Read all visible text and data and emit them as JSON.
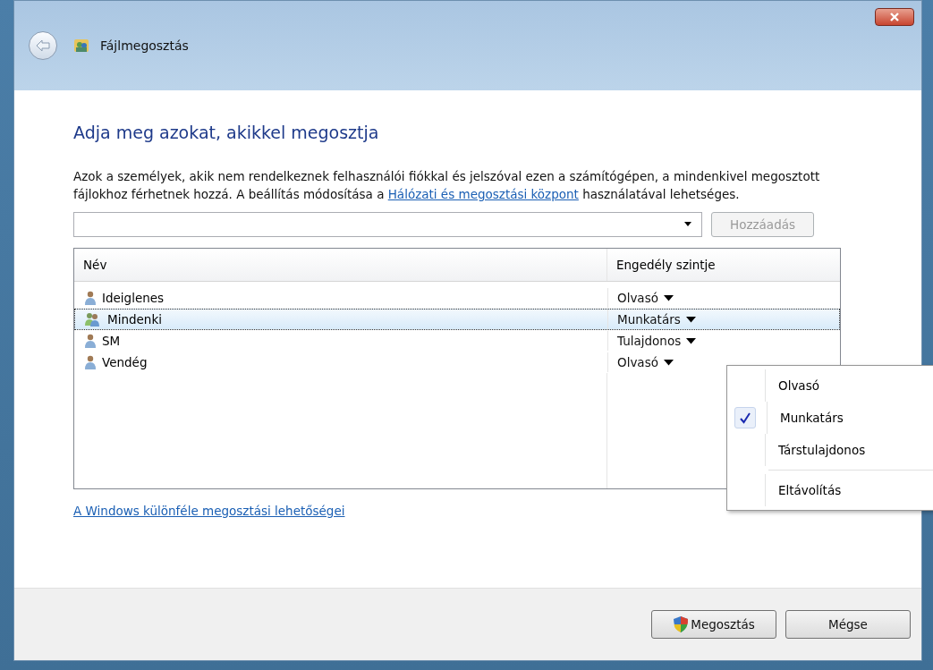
{
  "window": {
    "title": "Fájlmegosztás"
  },
  "heading": "Adja meg azokat, akikkel megosztja",
  "description": {
    "before": "Azok a személyek, akik nem rendelkeznek felhasználói fiókkal és jelszóval ezen a számítógépen, a mindenkivel megosztott fájlokhoz férhetnek hozzá. A beállítás módosítása a ",
    "link": "Hálózati és megosztási központ",
    "after": " használatával lehetséges."
  },
  "add_button": {
    "label": "Hozzáadás",
    "disabled": true
  },
  "table": {
    "columns": [
      "Név",
      "Engedély szintje"
    ],
    "rows": [
      {
        "name": "Ideiglenes",
        "kind": "user",
        "permission": "Olvasó",
        "selected": false
      },
      {
        "name": "Mindenki",
        "kind": "group",
        "permission": "Munkatárs",
        "selected": true
      },
      {
        "name": "SM",
        "kind": "user",
        "permission": "Tulajdonos",
        "selected": false
      },
      {
        "name": "Vendég",
        "kind": "user",
        "permission": "Olvasó",
        "selected": false
      }
    ]
  },
  "menu": [
    {
      "label": "Olvasó",
      "kind": "option",
      "checked": false
    },
    {
      "label": "Munkatárs",
      "kind": "option",
      "checked": true
    },
    {
      "label": "Társtulajdonos",
      "kind": "option",
      "checked": false
    },
    {
      "label": "Eltávolítás",
      "kind": "action",
      "checked": false
    }
  ],
  "options_link": "A Windows különféle megosztási lehetőségei",
  "buttons": [
    {
      "label": "Megosztás",
      "kind": "shield"
    },
    {
      "label": "Mégse",
      "kind": "plain"
    }
  ]
}
